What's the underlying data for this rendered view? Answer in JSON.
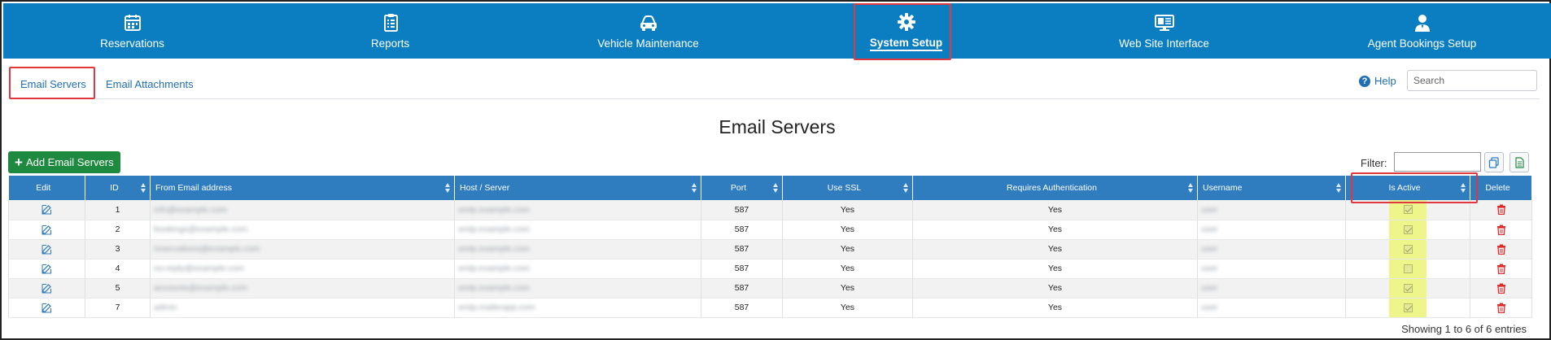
{
  "nav": {
    "items": [
      {
        "label": "Reservations",
        "icon": "calendar-icon"
      },
      {
        "label": "Reports",
        "icon": "clipboard-checklist-icon"
      },
      {
        "label": "Vehicle Maintenance",
        "icon": "car-icon"
      },
      {
        "label": "System Setup",
        "icon": "gear-icon",
        "active": true
      },
      {
        "label": "Web Site Interface",
        "icon": "monitor-icon"
      },
      {
        "label": "Agent Bookings Setup",
        "icon": "user-agent-icon"
      }
    ]
  },
  "subnav": {
    "tabs": [
      {
        "label": "Email Servers",
        "active": true
      },
      {
        "label": "Email Attachments"
      }
    ],
    "help_label": "Help",
    "search_placeholder": "Search"
  },
  "page": {
    "title": "Email Servers",
    "add_button_label": "Add Email Servers",
    "filter_label": "Filter:",
    "filter_value": ""
  },
  "table": {
    "columns": [
      "Edit",
      "ID",
      "From Email address",
      "Host / Server",
      "Port",
      "Use SSL",
      "Requires Authentication",
      "Username",
      "Is Active",
      "Delete"
    ],
    "rows": [
      {
        "id": "1",
        "from_email": "info@example.com",
        "host": "smtp.example.com",
        "port": "587",
        "use_ssl": "Yes",
        "requires_auth": "Yes",
        "username": "user",
        "is_active": true
      },
      {
        "id": "2",
        "from_email": "bookings@example.com",
        "host": "smtp.example.com",
        "port": "587",
        "use_ssl": "Yes",
        "requires_auth": "Yes",
        "username": "user",
        "is_active": true
      },
      {
        "id": "3",
        "from_email": "reservations@example.com",
        "host": "smtp.example.com",
        "port": "587",
        "use_ssl": "Yes",
        "requires_auth": "Yes",
        "username": "user",
        "is_active": true
      },
      {
        "id": "4",
        "from_email": "no-reply@example.com",
        "host": "smtp.example.com",
        "port": "587",
        "use_ssl": "Yes",
        "requires_auth": "Yes",
        "username": "user",
        "is_active": false
      },
      {
        "id": "5",
        "from_email": "accounts@example.com",
        "host": "smtp.example.com",
        "port": "587",
        "use_ssl": "Yes",
        "requires_auth": "Yes",
        "username": "user",
        "is_active": true
      },
      {
        "id": "7",
        "from_email": "admin",
        "host": "smtp.mailerapp.com",
        "port": "587",
        "use_ssl": "Yes",
        "requires_auth": "Yes",
        "username": "user",
        "is_active": true
      }
    ]
  },
  "footer": {
    "info": "Showing 1 to 6 of 6 entries"
  },
  "colors": {
    "nav_bg": "#0b7ec2",
    "header_bg": "#2f7cbf",
    "add_button": "#1e8a3f",
    "delete_icon": "#e02b2b",
    "highlight_box": "#e0383e",
    "active_column_highlight": "#eef58a"
  }
}
